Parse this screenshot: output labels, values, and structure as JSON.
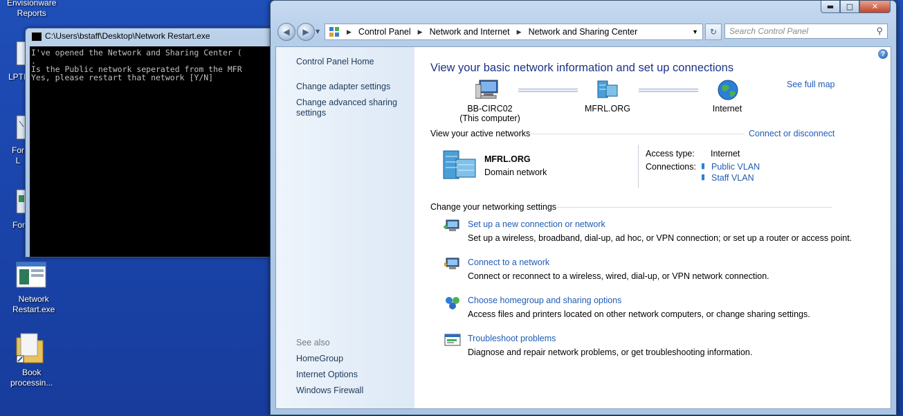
{
  "desktop": {
    "icons": [
      {
        "label": "Envisionware\nReports"
      },
      {
        "label": "LPTI"
      },
      {
        "label": "For\nL"
      },
      {
        "label": "For"
      },
      {
        "label": "Network\nRestart.exe"
      },
      {
        "label": "Book\nprocessin..."
      }
    ]
  },
  "cmd": {
    "title": "C:\\Users\\bstaff\\Desktop\\Network Restart.exe",
    "lines": "I've opened the Network and Sharing Center (\n.\nIs the Public network seperated from the MFR\nYes, please restart that network [Y/N]"
  },
  "explorer": {
    "address": {
      "crumbs": [
        "Control Panel",
        "Network and Internet",
        "Network and Sharing Center"
      ]
    },
    "search_placeholder": "Search Control Panel",
    "left_pane": {
      "home": "Control Panel Home",
      "adapter": "Change adapter settings",
      "advanced": "Change advanced sharing\nsettings",
      "see_also": "See also",
      "homegroup": "HomeGroup",
      "internet_options": "Internet Options",
      "firewall": "Windows Firewall"
    },
    "main": {
      "title": "View your basic network information and set up connections",
      "see_full_map": "See full map",
      "map": {
        "computer": "BB-CIRC02\n(This computer)",
        "network": "MFRL.ORG",
        "internet": "Internet"
      },
      "active_networks_label": "View your active networks",
      "connect_disconnect": "Connect or disconnect",
      "network_name": "MFRL.ORG",
      "network_type": "Domain network",
      "access_type_label": "Access type:",
      "access_type_value": "Internet",
      "connections_label": "Connections:",
      "connections": [
        "Public VLAN",
        "Staff VLAN"
      ],
      "change_settings_label": "Change your networking settings",
      "tasks": [
        {
          "link": "Set up a new connection or network",
          "desc": "Set up a wireless, broadband, dial-up, ad hoc, or VPN connection; or set up a router or access point."
        },
        {
          "link": "Connect to a network",
          "desc": "Connect or reconnect to a wireless, wired, dial-up, or VPN network connection."
        },
        {
          "link": "Choose homegroup and sharing options",
          "desc": "Access files and printers located on other network computers, or change sharing settings."
        },
        {
          "link": "Troubleshoot problems",
          "desc": "Diagnose and repair network problems, or get troubleshooting information."
        }
      ]
    }
  }
}
